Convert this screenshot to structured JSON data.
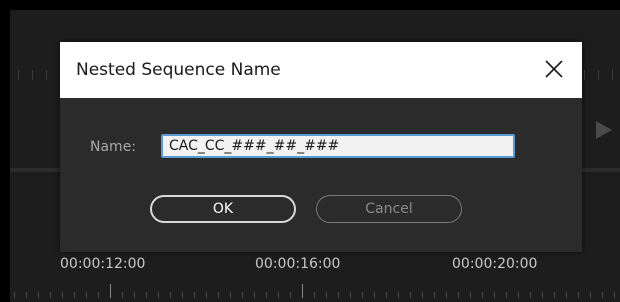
{
  "dialog": {
    "title": "Nested Sequence Name",
    "close_icon": "close-icon",
    "name_label": "Name:",
    "name_value": "CAC_CC_###_##_###",
    "ok_label": "OK",
    "cancel_label": "Cancel"
  },
  "timeline": {
    "timecodes": [
      "00:00:12:00",
      "00:00:16:00",
      "00:00:20:00"
    ],
    "play_icon": "play-icon"
  },
  "colors": {
    "titlebar": "#ffffff",
    "dialog_bg": "#2b2b2b",
    "panel_bg": "#1d1d1d",
    "input_focus_border": "#5b9bd5"
  }
}
